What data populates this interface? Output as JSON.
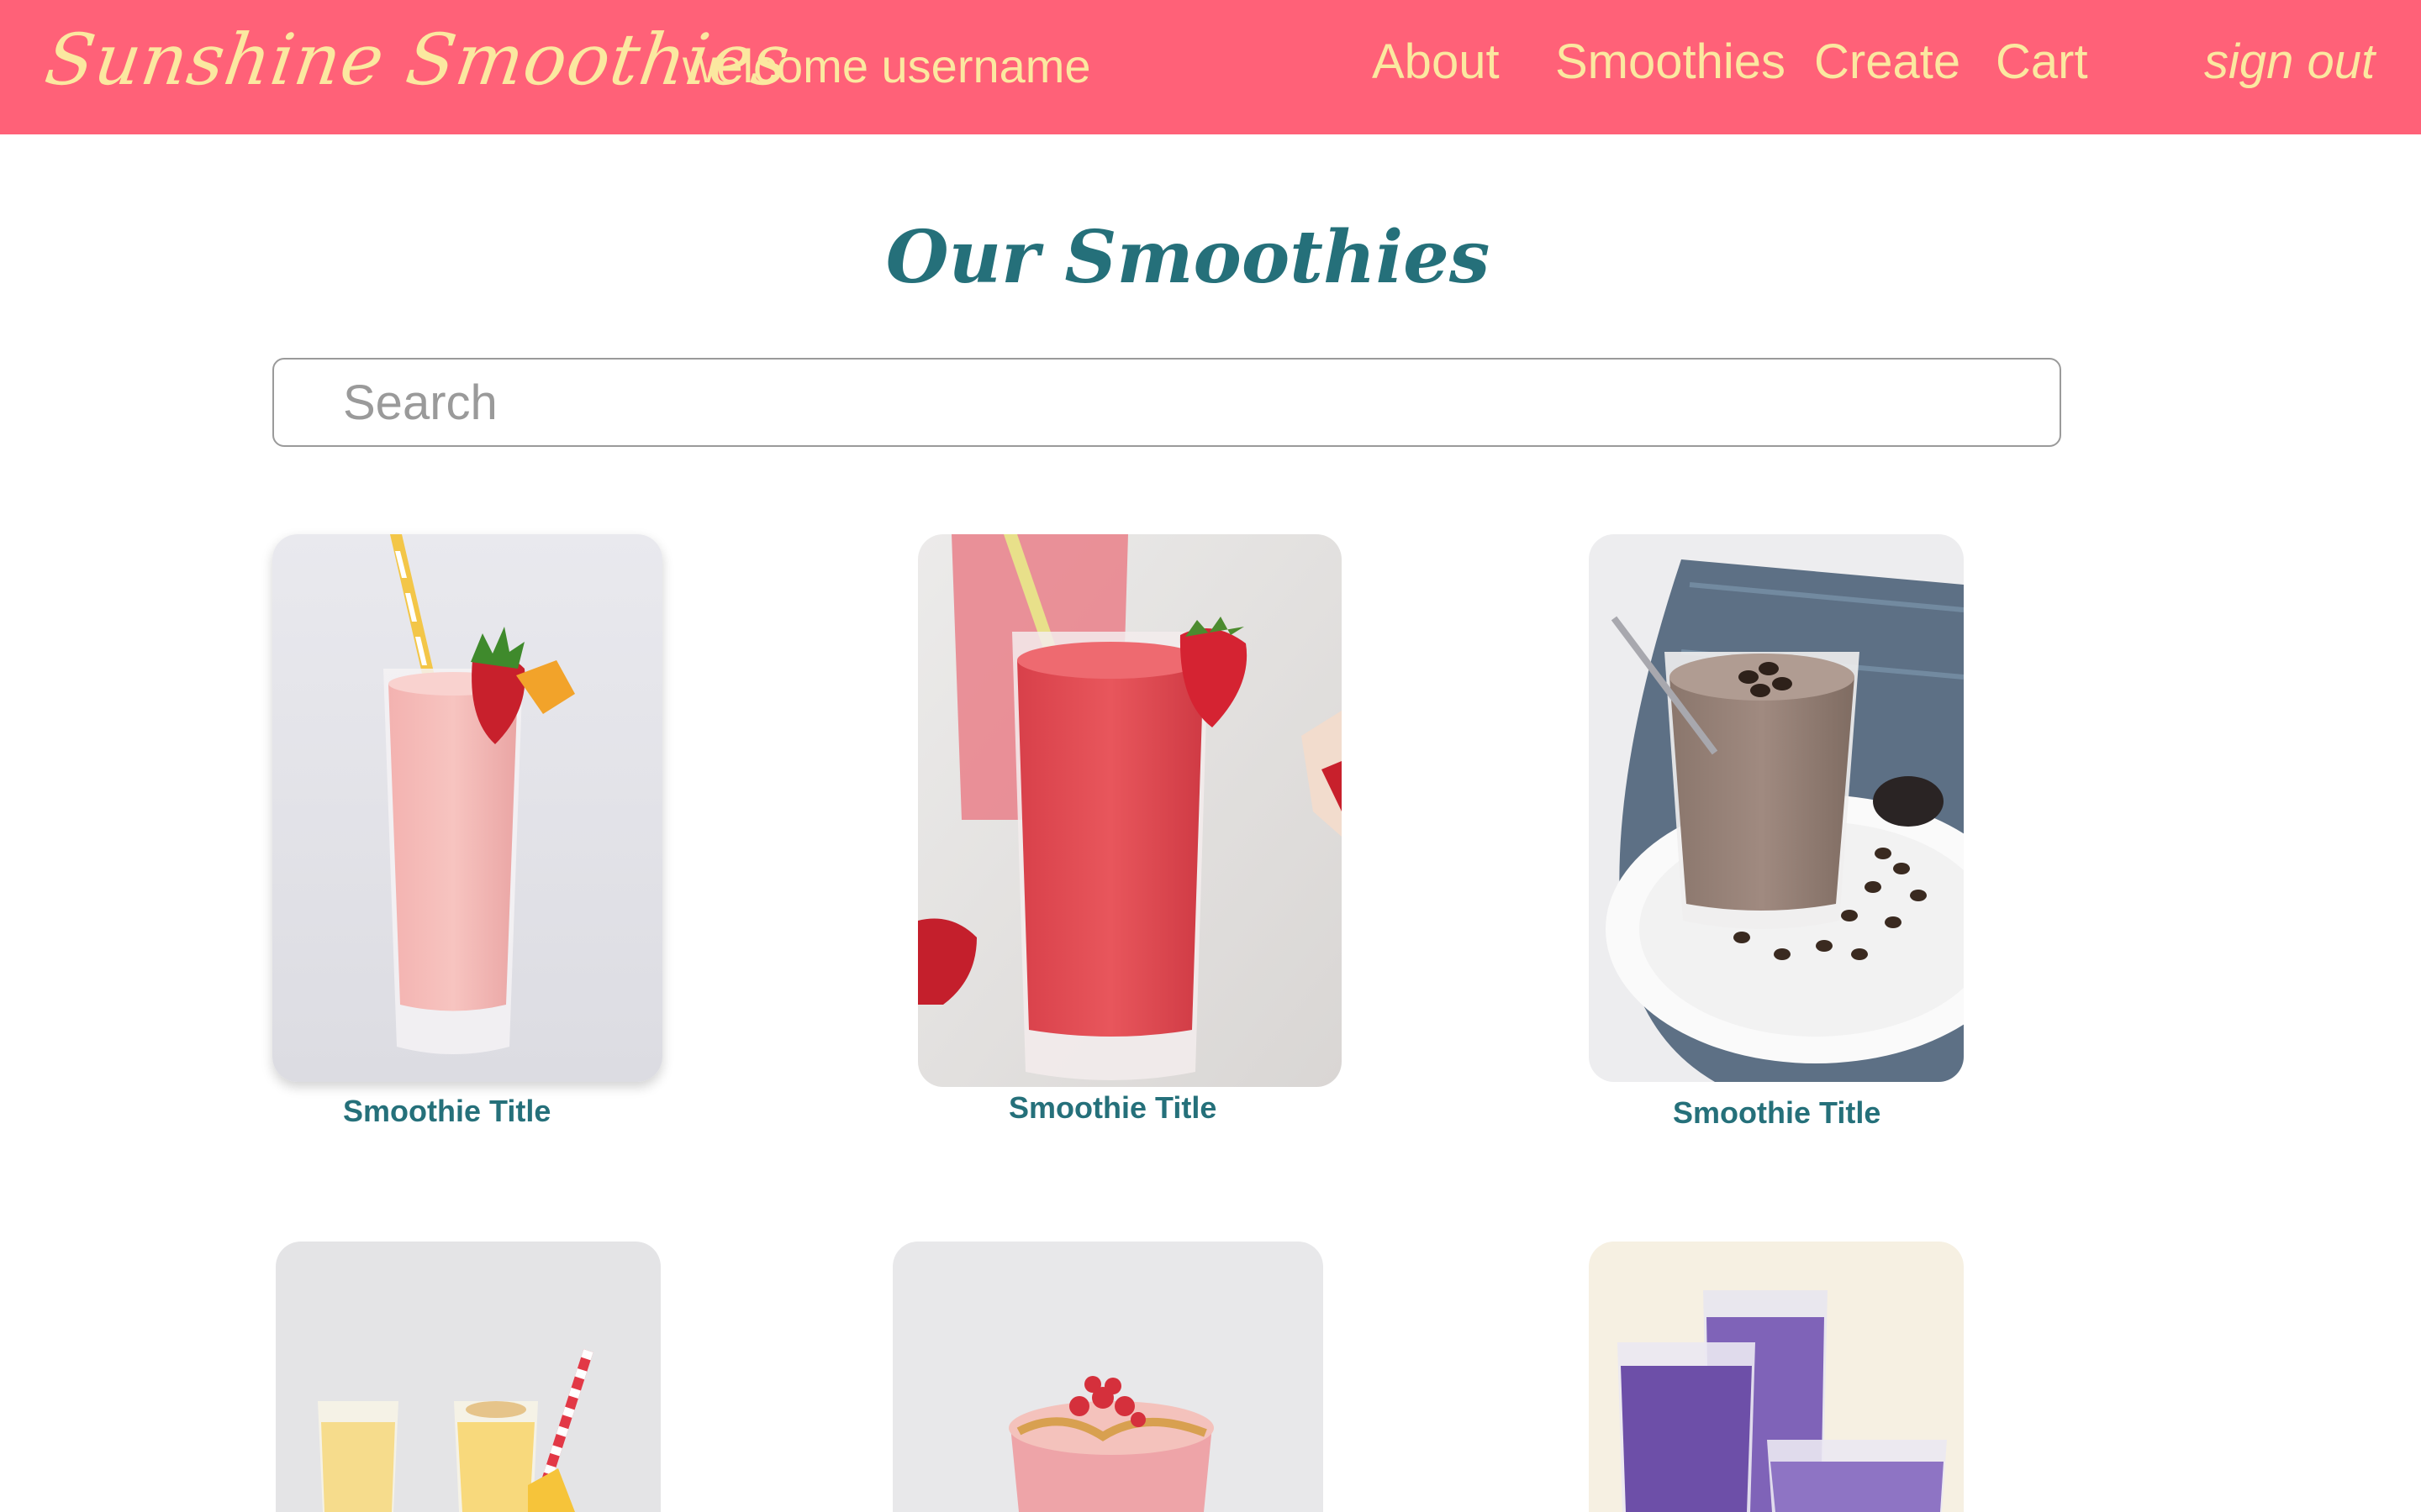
{
  "navbar": {
    "brand": "Sunshine Smoothies",
    "welcome": "welcome username",
    "links": {
      "about": "About",
      "smoothies": "Smoothies",
      "create": "Create",
      "cart": "Cart",
      "sign_out": "sign out"
    }
  },
  "page": {
    "title": "Our Smoothies"
  },
  "search": {
    "placeholder": "Search",
    "value": ""
  },
  "smoothies": [
    {
      "title": "Smoothie Title"
    },
    {
      "title": "Smoothie Title"
    },
    {
      "title": "Smoothie Title"
    },
    {
      "title": ""
    },
    {
      "title": ""
    },
    {
      "title": ""
    }
  ],
  "colors": {
    "navbar_bg": "#ff6178",
    "navbar_text": "#fbe8a0",
    "accent_teal": "#25707a",
    "search_border": "#9a9a9a"
  }
}
